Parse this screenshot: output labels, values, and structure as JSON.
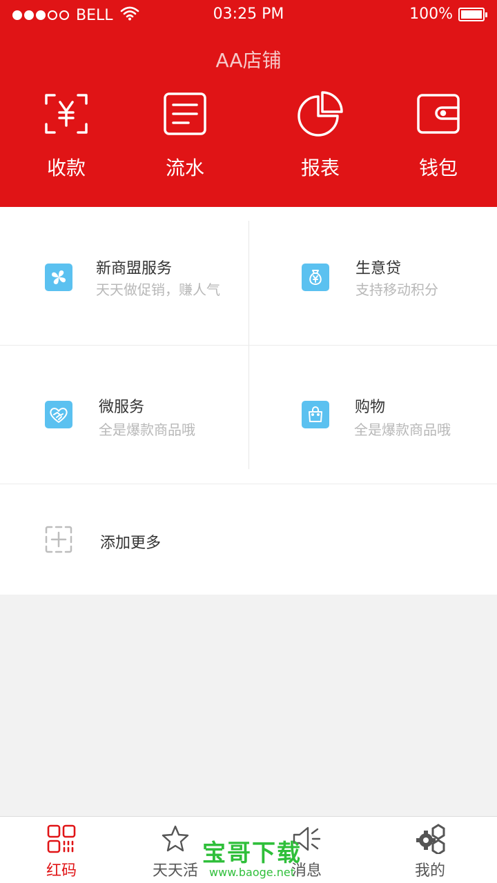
{
  "status_bar": {
    "carrier": "BELL",
    "time": "03:25 PM",
    "battery": "100%",
    "signal_filled": 3,
    "signal_total": 5
  },
  "header": {
    "shop_name": "AA店铺",
    "actions": [
      {
        "label": "收款",
        "icon": "yuan-scan-icon"
      },
      {
        "label": "流水",
        "icon": "document-list-icon"
      },
      {
        "label": "报表",
        "icon": "pie-chart-icon"
      },
      {
        "label": "钱包",
        "icon": "wallet-icon"
      }
    ]
  },
  "services": [
    {
      "title": "新商盟服务",
      "subtitle": "天天做促销，赚人气",
      "icon": "pinwheel-icon"
    },
    {
      "title": "生意贷",
      "subtitle": "支持移动积分",
      "icon": "money-bag-icon"
    },
    {
      "title": "微服务",
      "subtitle": "全是爆款商品哦",
      "icon": "heart-handshake-icon"
    },
    {
      "title": "购物",
      "subtitle": "全是爆款商品哦",
      "icon": "shopping-bag-icon"
    }
  ],
  "add_more": {
    "label": "添加更多",
    "icon": "add-box-icon"
  },
  "tabbar": {
    "tabs": [
      {
        "label": "红码",
        "icon": "qr-code-icon",
        "active": true
      },
      {
        "label": "天天活",
        "icon": "star-icon",
        "active": false
      },
      {
        "label": "消息",
        "icon": "megaphone-icon",
        "active": false
      },
      {
        "label": "我的",
        "icon": "gears-icon",
        "active": false
      }
    ]
  },
  "watermark": {
    "main": "宝哥下载",
    "sub": "www.baoge.net"
  },
  "colors": {
    "brand_red": "#e01416",
    "service_blue": "#5bc1f0",
    "watermark_green": "#2fbf3a"
  }
}
